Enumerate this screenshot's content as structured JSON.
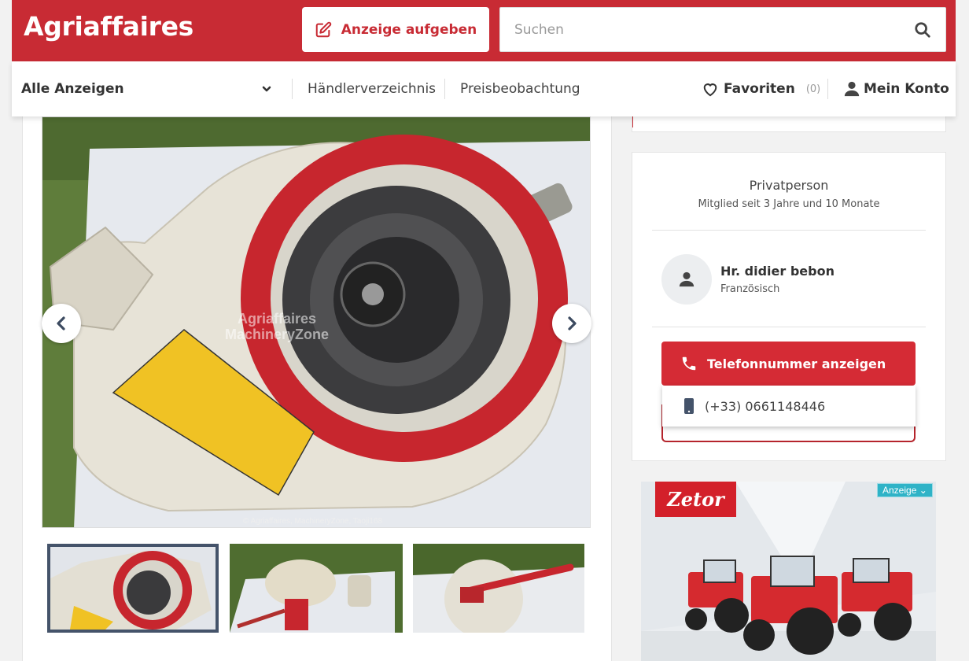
{
  "header": {
    "logo": "Agriaffaires",
    "post_ad_label": "Anzeige aufgeben",
    "search_placeholder": "Suchen"
  },
  "nav": {
    "all_ads": "Alle Anzeigen",
    "dealer_directory": "Händlerverzeichnis",
    "price_watch": "Preisbeobachtung",
    "favorites": "Favoriten",
    "favorites_count": "(0)",
    "account": "Mein Konto"
  },
  "gallery": {
    "watermark_line1": "Agriaffaires",
    "watermark_line2": "MachineryZone",
    "copyright": "© Agriaffaires, MachineryZone, Taoji168"
  },
  "seller": {
    "type": "Privatperson",
    "member_since": "Mitglied seit 3 Jahre und 10 Monate",
    "name": "Hr. didier bebon",
    "language": "Französisch",
    "phone_button": "Telefonnummer anzeigen",
    "phone_number": "(+33) 0661148446"
  },
  "ad": {
    "brand": "Zetor",
    "badge": "Anzeige"
  },
  "colors": {
    "brand_red": "#c82b34",
    "ad_badge": "#2fb3c7"
  }
}
